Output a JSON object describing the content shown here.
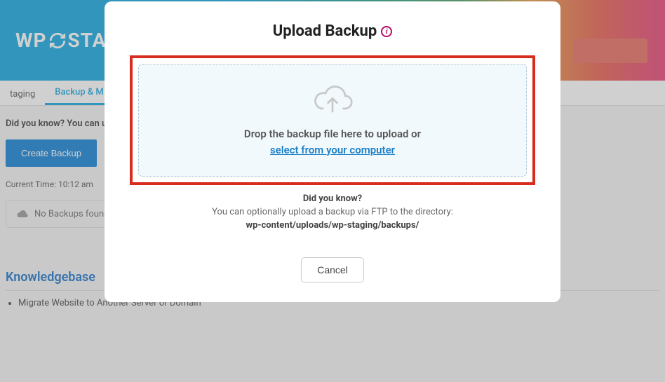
{
  "header": {
    "logo_prefix": "WP",
    "logo_suffix": "STA"
  },
  "tabs": {
    "staging": "taging",
    "backup": "Backup & M"
  },
  "background": {
    "did_you_know": "Did you know? You can u",
    "create_backup_label": "Create Backup",
    "current_time_label": "Current Time:",
    "current_time_value": "10:12 am",
    "no_backups": "No Backups found.",
    "knowledgebase_heading": "Knowledgebase",
    "kb_item_1": "Migrate Website to Another Server or Domain"
  },
  "modal": {
    "title": "Upload Backup",
    "dropzone_text": "Drop the backup file here to upload or",
    "select_link": "select from your computer",
    "tip_heading": "Did you know?",
    "tip_text": "You can optionally upload a backup via FTP to the directory:",
    "tip_path": "wp-content/uploads/wp-staging/backups/",
    "cancel_label": "Cancel"
  }
}
